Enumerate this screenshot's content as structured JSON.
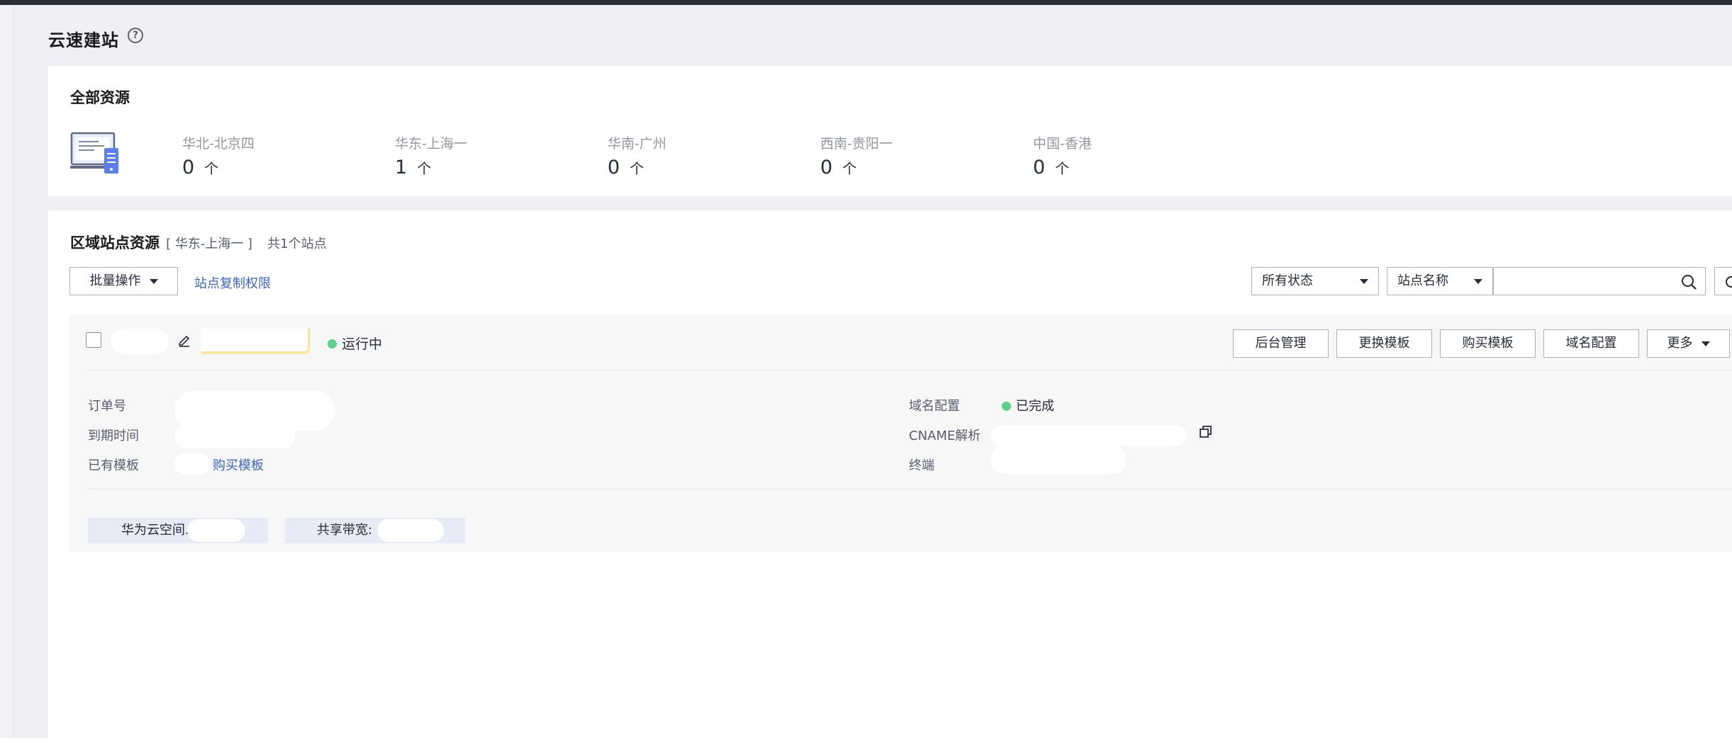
{
  "header": {
    "title": "云速建站",
    "help_icon": "question-circle-icon"
  },
  "all_resources": {
    "title": "全部资源",
    "icon": "monitor-icon",
    "regions": [
      {
        "name": "华北-北京四",
        "count": "0",
        "unit": "个"
      },
      {
        "name": "华东-上海一",
        "count": "1",
        "unit": "个"
      },
      {
        "name": "华南-广州",
        "count": "0",
        "unit": "个"
      },
      {
        "name": "西南-贵阳一",
        "count": "0",
        "unit": "个"
      },
      {
        "name": "中国-香港",
        "count": "0",
        "unit": "个"
      }
    ]
  },
  "site_resources": {
    "title": "区域站点资源",
    "region_label": "[ 华东-上海一 ]",
    "count_label": "共1个站点",
    "batch_button": "批量操作",
    "copy_permission_link": "站点复制权限",
    "status_filter": "所有状态",
    "search_field": "站点名称",
    "search_placeholder": "",
    "site": {
      "status": "运行中",
      "status_color": "#5ad18d",
      "actions": [
        "后台管理",
        "更换模板",
        "购买模板",
        "域名配置",
        "更多"
      ],
      "details_left": [
        {
          "label": "订单号"
        },
        {
          "label": "到期时间"
        },
        {
          "label": "已有模板",
          "link": "购买模板"
        }
      ],
      "details_right": [
        {
          "label": "域名配置",
          "value": "已完成"
        },
        {
          "label": "CNAME解析"
        },
        {
          "label": "终端"
        }
      ],
      "tags": [
        "华为云空间.",
        "共享带宽:"
      ]
    }
  },
  "colors": {
    "accent_link": "#3a63c8",
    "success": "#5ad18d",
    "background": "#eef0f5"
  }
}
